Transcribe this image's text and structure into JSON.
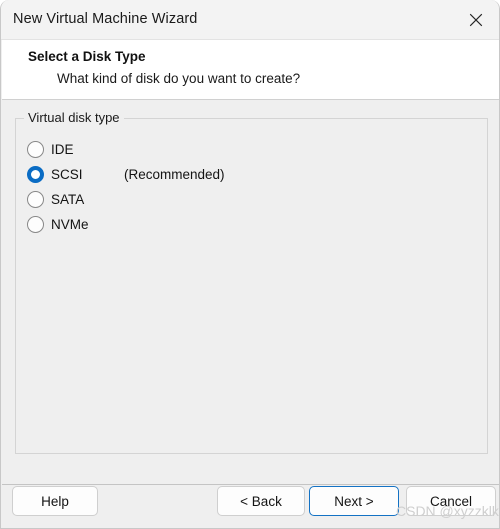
{
  "window": {
    "title": "New Virtual Machine Wizard",
    "close_icon": "close-icon"
  },
  "header": {
    "title": "Select a Disk Type",
    "subtitle": "What kind of disk do you want to create?"
  },
  "content": {
    "groupbox_legend": "Virtual disk type",
    "options": [
      {
        "label": "IDE",
        "note": "",
        "selected": false
      },
      {
        "label": "SCSI",
        "note": "(Recommended)",
        "selected": true
      },
      {
        "label": "SATA",
        "note": "",
        "selected": false
      },
      {
        "label": "NVMe",
        "note": "",
        "selected": false
      }
    ]
  },
  "footer": {
    "help_label": "Help",
    "back_label": "< Back",
    "next_label": "Next >",
    "cancel_label": "Cancel"
  },
  "watermark": {
    "text": "CSDN @xyzzklk"
  },
  "colors": {
    "accent": "#0a6cc4",
    "focus_border": "#1472c4",
    "titlebar": "#f3f3f3",
    "content_bg": "#efefef"
  }
}
